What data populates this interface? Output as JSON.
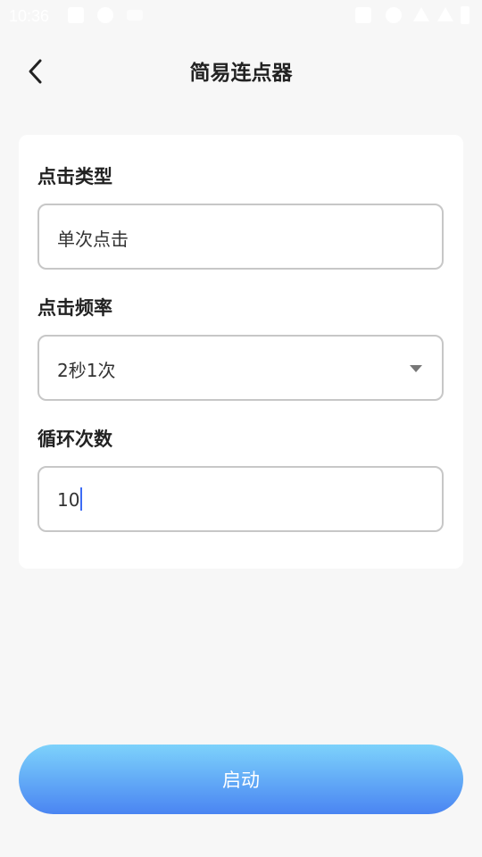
{
  "status_bar": {
    "time": "10:36",
    "icons": [
      "image-icon",
      "download-icon",
      "wifi-icon",
      "briefcase-icon",
      "dnd-icon",
      "wifi-signal-icon",
      "cell-signal-icon",
      "battery-icon"
    ]
  },
  "header": {
    "title": "简易连点器",
    "back_icon": "chevron-left-icon"
  },
  "form": {
    "click_type": {
      "label": "点击类型",
      "value": "单次点击"
    },
    "click_frequency": {
      "label": "点击频率",
      "value": "2秒1次",
      "dropdown_icon": "triangle-down-icon"
    },
    "loop_count": {
      "label": "循环次数",
      "value": "10"
    }
  },
  "start_button": {
    "label": "启动"
  },
  "colors": {
    "background": "#f7f7f7",
    "card": "#ffffff",
    "border": "#c7c7c7",
    "caret": "#3d6cf5",
    "button_gradient_top": "#7dd2fb",
    "button_gradient_bottom": "#4a85f2"
  }
}
